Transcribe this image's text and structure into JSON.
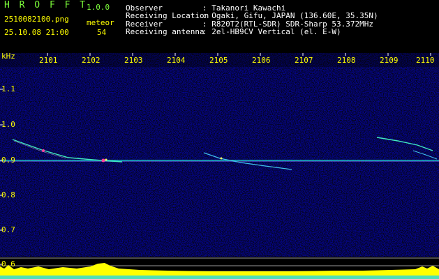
{
  "app": {
    "name": "H R O F F T",
    "version": "1.0.0"
  },
  "file": {
    "name": "2510082100.png",
    "datetime": "25.10.08 21:00"
  },
  "meteor": {
    "label": "meteor",
    "count": "54"
  },
  "info": [
    {
      "label": "Observer",
      "value": ": Takanori Kawachi"
    },
    {
      "label": "Receiving Location",
      "value": ": Ogaki, Gifu, JAPAN (136.60E, 35.35N)"
    },
    {
      "label": "Receiver",
      "value": ": R820T2(RTL-SDR) SDR-Sharp 53.372MHz"
    },
    {
      "label": "Receiving antenna",
      "value": ": 2el-HB9CV Vertical (el. E-W)"
    }
  ],
  "axis": {
    "unit": "kHz",
    "x_ticks": [
      "2101",
      "2102",
      "2103",
      "2104",
      "2105",
      "2106",
      "2107",
      "2108",
      "2109",
      "2110"
    ],
    "y_ticks": [
      "1.1",
      "1.0",
      "0.9",
      "0.8",
      "0.7",
      "0.6"
    ]
  },
  "colors": {
    "green": "#7cfc3a",
    "yellow": "#ffff00",
    "cyan": "#30e0e0",
    "white": "#ffffff",
    "background_noise": "#1a1a70"
  }
}
